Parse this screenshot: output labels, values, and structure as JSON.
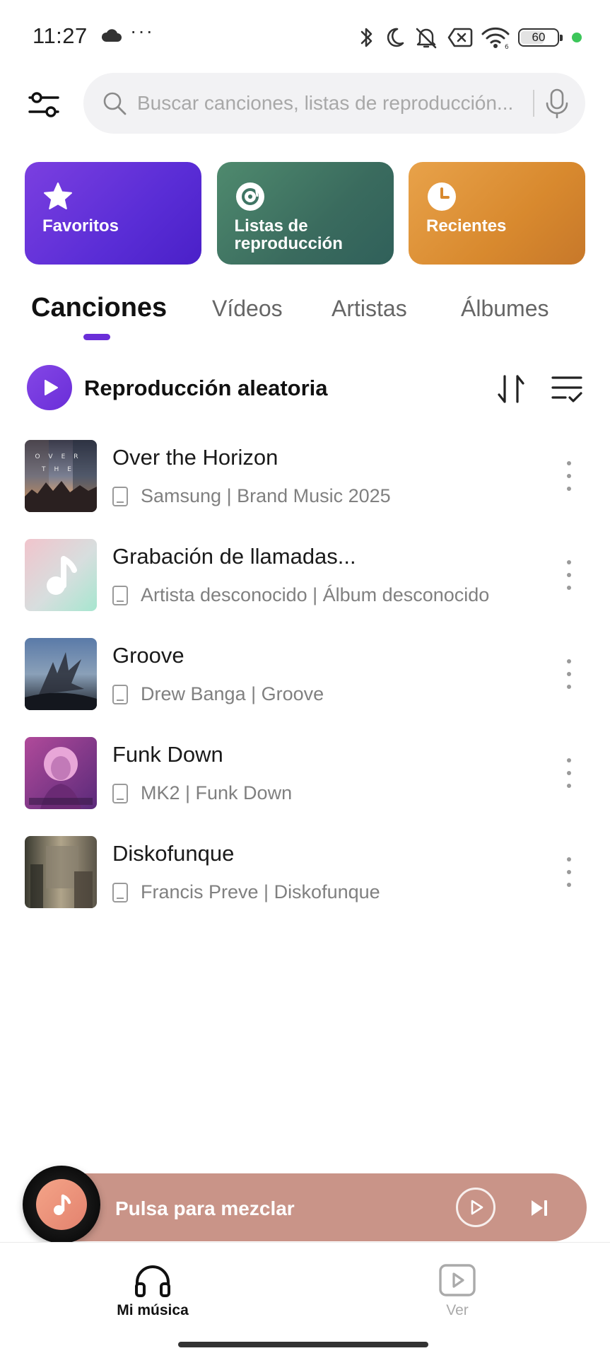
{
  "status_bar": {
    "time": "11:27",
    "dots": "···",
    "battery": "60"
  },
  "search": {
    "placeholder": "Buscar canciones, listas de reproducción..."
  },
  "cards": [
    {
      "label": "Favoritos",
      "icon": "star-icon",
      "color": "#6a2ed8"
    },
    {
      "label": "Listas de reproducción",
      "icon": "disc-icon",
      "color": "#3f7564"
    },
    {
      "label": "Recientes",
      "icon": "clock-icon",
      "color": "#d8892e"
    }
  ],
  "tabs": [
    {
      "label": "Canciones",
      "active": true
    },
    {
      "label": "Vídeos",
      "active": false
    },
    {
      "label": "Artistas",
      "active": false
    },
    {
      "label": "Álbumes",
      "active": false
    }
  ],
  "shuffle": {
    "label": "Reproducción aleatoria"
  },
  "songs": [
    {
      "title": "Over the Horizon",
      "meta": "Samsung | Brand Music 2025"
    },
    {
      "title": "Grabación de llamadas...",
      "meta": "Artista desconocido | Álbum desconocido"
    },
    {
      "title": "Groove",
      "meta": "Drew Banga | Groove"
    },
    {
      "title": "Funk Down",
      "meta": "MK2 | Funk Down"
    },
    {
      "title": "Diskofunque",
      "meta": "Francis Preve | Diskofunque"
    }
  ],
  "mini_player": {
    "label": "Pulsa para mezclar"
  },
  "bottom_nav": [
    {
      "label": "Mi música",
      "active": true
    },
    {
      "label": "Ver",
      "active": false
    }
  ],
  "colors": {
    "accent": "#6a2ed8",
    "mini_player": "#c99488"
  }
}
